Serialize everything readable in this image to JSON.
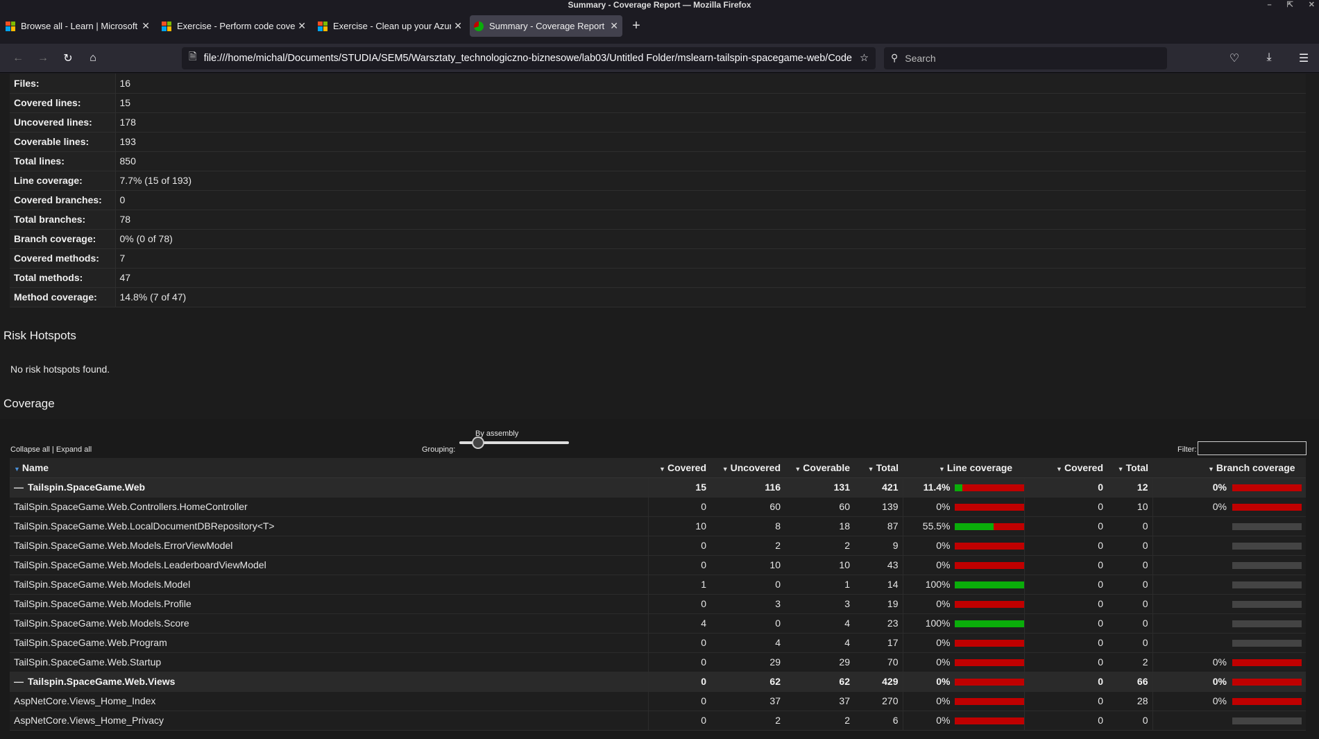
{
  "window": {
    "title": "Summary - Coverage Report — Mozilla Firefox"
  },
  "tabs": [
    {
      "label": "Browse all - Learn | Microsoft",
      "favicon": "microsoft-icon",
      "active": false
    },
    {
      "label": "Exercise - Perform code coverage",
      "favicon": "microsoft-icon",
      "active": false
    },
    {
      "label": "Exercise - Clean up your Azure",
      "favicon": "microsoft-icon",
      "active": false
    },
    {
      "label": "Summary - Coverage Report",
      "favicon": "report-icon",
      "active": true
    }
  ],
  "navbar": {
    "url": "file:///home/michal/Documents/STUDIA/SEM5/Warsztaty_technologiczno-biznesowe/lab03/Untitled Folder/mslearn-tailspin-spacegame-web/Code",
    "search_placeholder": "Search"
  },
  "summary": [
    {
      "label": "Files:",
      "value": "16"
    },
    {
      "label": "Covered lines:",
      "value": "15"
    },
    {
      "label": "Uncovered lines:",
      "value": "178"
    },
    {
      "label": "Coverable lines:",
      "value": "193"
    },
    {
      "label": "Total lines:",
      "value": "850"
    },
    {
      "label": "Line coverage:",
      "value": "7.7% (15 of 193)"
    },
    {
      "label": "Covered branches:",
      "value": "0"
    },
    {
      "label": "Total branches:",
      "value": "78"
    },
    {
      "label": "Branch coverage:",
      "value": "0% (0 of 78)"
    },
    {
      "label": "Covered methods:",
      "value": "7"
    },
    {
      "label": "Total methods:",
      "value": "47"
    },
    {
      "label": "Method coverage:",
      "value": "14.8% (7 of 47)"
    }
  ],
  "risk": {
    "title": "Risk Hotspots",
    "text": "No risk hotspots found."
  },
  "coverage": {
    "title": "Coverage",
    "collapse_all": "Collapse all",
    "separator": " | ",
    "expand_all": "Expand all",
    "grouping_label": "Grouping:",
    "grouping_value": "By assembly",
    "filter_label": "Filter:",
    "filter_value": "",
    "headers": {
      "name": "Name",
      "covered": "Covered",
      "uncovered": "Uncovered",
      "coverable": "Coverable",
      "total": "Total",
      "line_coverage": "Line coverage",
      "br_covered": "Covered",
      "br_total": "Total",
      "branch_coverage": "Branch coverage"
    },
    "rows": [
      {
        "group": true,
        "name": "Tailspin.SpaceGame.Web",
        "covered": "15",
        "uncovered": "116",
        "coverable": "131",
        "total": "421",
        "line_pct": "11.4%",
        "line_frac": 0.114,
        "br_covered": "0",
        "br_total": "12",
        "br_pct": "0%",
        "br_frac": 0,
        "has_branch": true
      },
      {
        "group": false,
        "name": "TailSpin.SpaceGame.Web.Controllers.HomeController",
        "covered": "0",
        "uncovered": "60",
        "coverable": "60",
        "total": "139",
        "line_pct": "0%",
        "line_frac": 0,
        "br_covered": "0",
        "br_total": "10",
        "br_pct": "0%",
        "br_frac": 0,
        "has_branch": true
      },
      {
        "group": false,
        "name": "TailSpin.SpaceGame.Web.LocalDocumentDBRepository<T>",
        "covered": "10",
        "uncovered": "8",
        "coverable": "18",
        "total": "87",
        "line_pct": "55.5%",
        "line_frac": 0.555,
        "br_covered": "0",
        "br_total": "0",
        "br_pct": "",
        "br_frac": 0,
        "has_branch": false
      },
      {
        "group": false,
        "name": "TailSpin.SpaceGame.Web.Models.ErrorViewModel",
        "covered": "0",
        "uncovered": "2",
        "coverable": "2",
        "total": "9",
        "line_pct": "0%",
        "line_frac": 0,
        "br_covered": "0",
        "br_total": "0",
        "br_pct": "",
        "br_frac": 0,
        "has_branch": false
      },
      {
        "group": false,
        "name": "TailSpin.SpaceGame.Web.Models.LeaderboardViewModel",
        "covered": "0",
        "uncovered": "10",
        "coverable": "10",
        "total": "43",
        "line_pct": "0%",
        "line_frac": 0,
        "br_covered": "0",
        "br_total": "0",
        "br_pct": "",
        "br_frac": 0,
        "has_branch": false
      },
      {
        "group": false,
        "name": "TailSpin.SpaceGame.Web.Models.Model",
        "covered": "1",
        "uncovered": "0",
        "coverable": "1",
        "total": "14",
        "line_pct": "100%",
        "line_frac": 1,
        "br_covered": "0",
        "br_total": "0",
        "br_pct": "",
        "br_frac": 0,
        "has_branch": false
      },
      {
        "group": false,
        "name": "TailSpin.SpaceGame.Web.Models.Profile",
        "covered": "0",
        "uncovered": "3",
        "coverable": "3",
        "total": "19",
        "line_pct": "0%",
        "line_frac": 0,
        "br_covered": "0",
        "br_total": "0",
        "br_pct": "",
        "br_frac": 0,
        "has_branch": false
      },
      {
        "group": false,
        "name": "TailSpin.SpaceGame.Web.Models.Score",
        "covered": "4",
        "uncovered": "0",
        "coverable": "4",
        "total": "23",
        "line_pct": "100%",
        "line_frac": 1,
        "br_covered": "0",
        "br_total": "0",
        "br_pct": "",
        "br_frac": 0,
        "has_branch": false
      },
      {
        "group": false,
        "name": "TailSpin.SpaceGame.Web.Program",
        "covered": "0",
        "uncovered": "4",
        "coverable": "4",
        "total": "17",
        "line_pct": "0%",
        "line_frac": 0,
        "br_covered": "0",
        "br_total": "0",
        "br_pct": "",
        "br_frac": 0,
        "has_branch": false
      },
      {
        "group": false,
        "name": "TailSpin.SpaceGame.Web.Startup",
        "covered": "0",
        "uncovered": "29",
        "coverable": "29",
        "total": "70",
        "line_pct": "0%",
        "line_frac": 0,
        "br_covered": "0",
        "br_total": "2",
        "br_pct": "0%",
        "br_frac": 0,
        "has_branch": true
      },
      {
        "group": true,
        "name": "Tailspin.SpaceGame.Web.Views",
        "covered": "0",
        "uncovered": "62",
        "coverable": "62",
        "total": "429",
        "line_pct": "0%",
        "line_frac": 0,
        "br_covered": "0",
        "br_total": "66",
        "br_pct": "0%",
        "br_frac": 0,
        "has_branch": true
      },
      {
        "group": false,
        "name": "AspNetCore.Views_Home_Index",
        "covered": "0",
        "uncovered": "37",
        "coverable": "37",
        "total": "270",
        "line_pct": "0%",
        "line_frac": 0,
        "br_covered": "0",
        "br_total": "28",
        "br_pct": "0%",
        "br_frac": 0,
        "has_branch": true
      },
      {
        "group": false,
        "name": "AspNetCore.Views_Home_Privacy",
        "covered": "0",
        "uncovered": "2",
        "coverable": "2",
        "total": "6",
        "line_pct": "0%",
        "line_frac": 0,
        "br_covered": "0",
        "br_total": "0",
        "br_pct": "",
        "br_frac": 0,
        "has_branch": false
      }
    ]
  },
  "colors": {
    "covered": "#0aad0a",
    "uncovered": "#c00000",
    "no_data": "#444444",
    "accent": "#4a90d9"
  }
}
